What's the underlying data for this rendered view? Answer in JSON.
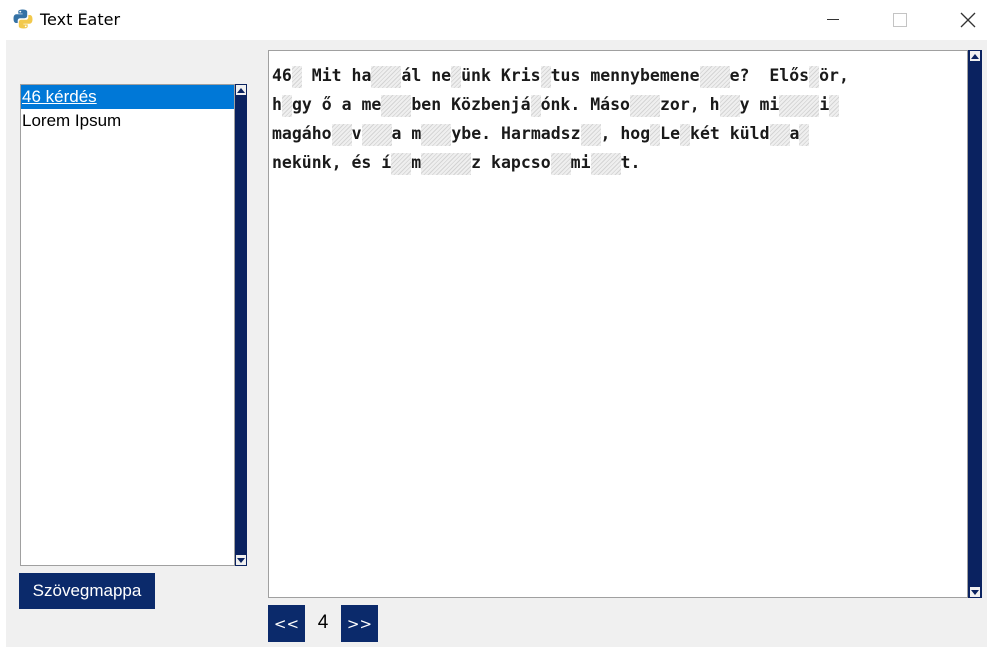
{
  "window": {
    "title": "Text Eater",
    "icons": [
      "python-icon",
      "minimize-icon",
      "maximize-icon",
      "close-icon"
    ]
  },
  "sidebar": {
    "items": [
      {
        "label": "46 kérdés",
        "selected": true
      },
      {
        "label": "Lorem Ipsum",
        "selected": false
      }
    ],
    "folder_button_label": "Szövegmappa"
  },
  "editor": {
    "lines": [
      [
        [
          "t",
          "46"
        ],
        [
          "g",
          1
        ],
        [
          "t",
          " Mit ha"
        ],
        [
          "g",
          3
        ],
        [
          "t",
          "ál ne"
        ],
        [
          "g",
          1
        ],
        [
          "t",
          "ünk Kris"
        ],
        [
          "g",
          1
        ],
        [
          "t",
          "tus mennybemene"
        ],
        [
          "g",
          3
        ],
        [
          "t",
          "e?  Elős"
        ],
        [
          "g",
          1
        ],
        [
          "t",
          "ör,"
        ]
      ],
      [
        [
          "t",
          "h"
        ],
        [
          "g",
          1
        ],
        [
          "t",
          "gy ő a me"
        ],
        [
          "g",
          3
        ],
        [
          "t",
          "ben Közbenjá"
        ],
        [
          "g",
          1
        ],
        [
          "t",
          "ónk. Máso"
        ],
        [
          "g",
          3
        ],
        [
          "t",
          "zor, h"
        ],
        [
          "g",
          2
        ],
        [
          "t",
          "y mi"
        ],
        [
          "g",
          4
        ],
        [
          "t",
          "i"
        ],
        [
          "g",
          1
        ]
      ],
      [
        [
          "t",
          "magáho"
        ],
        [
          "g",
          2
        ],
        [
          "t",
          "v"
        ],
        [
          "g",
          3
        ],
        [
          "t",
          "a m"
        ],
        [
          "g",
          3
        ],
        [
          "t",
          "ybe. Harmadsz"
        ],
        [
          "g",
          2
        ],
        [
          "t",
          ", hog"
        ],
        [
          "g",
          1
        ],
        [
          "t",
          "Le"
        ],
        [
          "g",
          1
        ],
        [
          "t",
          "két küld"
        ],
        [
          "g",
          2
        ],
        [
          "t",
          "a"
        ],
        [
          "g",
          1
        ]
      ],
      [
        [
          "t",
          "nekünk, és í"
        ],
        [
          "g",
          2
        ],
        [
          "t",
          "m"
        ],
        [
          "g",
          5
        ],
        [
          "t",
          "z kapcso"
        ],
        [
          "g",
          2
        ],
        [
          "t",
          "mi"
        ],
        [
          "g",
          3
        ],
        [
          "t",
          "t."
        ]
      ]
    ]
  },
  "pager": {
    "prev_label": "<<",
    "page": "4",
    "next_label": ">>"
  },
  "colors": {
    "navy": "#0b2a6b",
    "selection": "#0078d7",
    "background": "#f0f0f0"
  }
}
